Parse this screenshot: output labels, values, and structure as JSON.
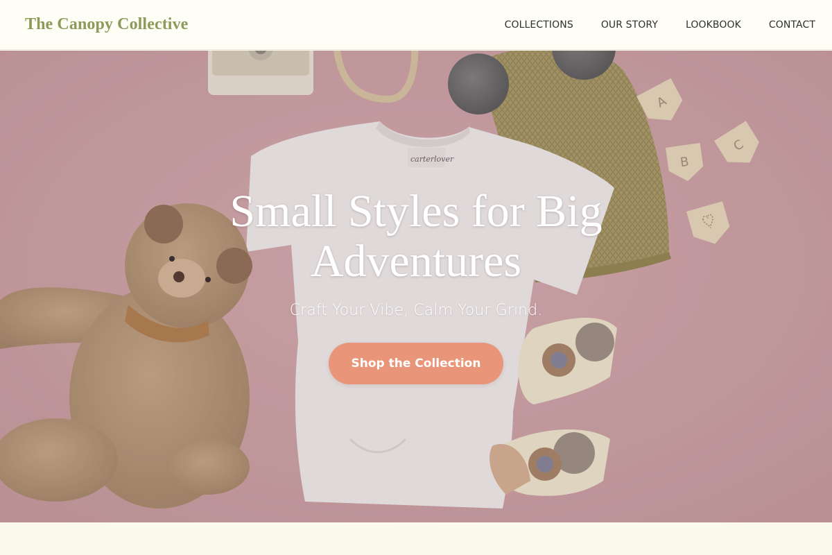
{
  "header": {
    "brand": "The Canopy Collective",
    "nav": [
      {
        "label": "COLLECTIONS"
      },
      {
        "label": "OUR STORY"
      },
      {
        "label": "LOOKBOOK"
      },
      {
        "label": "CONTACT"
      }
    ]
  },
  "hero": {
    "title": "Small Styles for Big Adventures",
    "subtitle": "Craft Your Vibe, Calm Your Grind.",
    "cta_label": "Shop the Collection",
    "tshirt_tag": "carterlover",
    "bunting_letters": [
      "A",
      "B",
      "C"
    ]
  },
  "colors": {
    "brand": "#8c9a5a",
    "header_bg": "#fefdf6",
    "hero_bg": "#cc9ea2",
    "cta": "#e8957a",
    "page_bg": "#fbfaec"
  }
}
